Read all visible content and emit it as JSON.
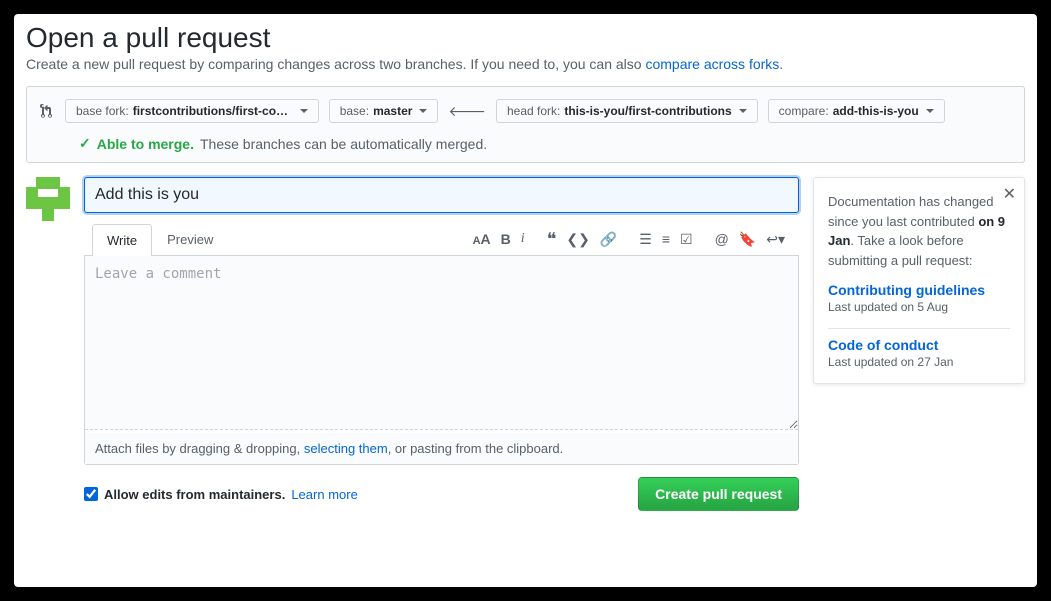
{
  "header": {
    "title": "Open a pull request",
    "subtitle_pre": "Create a new pull request by comparing changes across two branches. If you need to, you can also ",
    "subtitle_link": "compare across forks",
    "subtitle_post": "."
  },
  "compare": {
    "base_fork_label": "base fork: ",
    "base_fork_value": "firstcontributions/first-contr…",
    "base_label": "base: ",
    "base_value": "master",
    "head_fork_label": "head fork: ",
    "head_fork_value": "this-is-you/first-contributions",
    "compare_label": "compare: ",
    "compare_value": "add-this-is-you",
    "merge_ok": "Able to merge.",
    "merge_desc": "These branches can be automatically merged."
  },
  "form": {
    "title_value": "Add this is you",
    "tab_write": "Write",
    "tab_preview": "Preview",
    "comment_placeholder": "Leave a comment",
    "attach_pre": "Attach files by dragging & dropping, ",
    "attach_link": "selecting them",
    "attach_post": ", or pasting from the clipboard.",
    "allow_edits_label": "Allow edits from maintainers.",
    "learn_more": "Learn more",
    "submit": "Create pull request"
  },
  "sidebar": {
    "intro_pre": "Documentation has changed since you last contributed ",
    "intro_bold": "on 9 Jan",
    "intro_post": ". Take a look before submitting a pull request:",
    "link1": "Contributing guidelines",
    "meta1": "Last updated on 5 Aug",
    "link2": "Code of conduct",
    "meta2": "Last updated on 27 Jan"
  }
}
